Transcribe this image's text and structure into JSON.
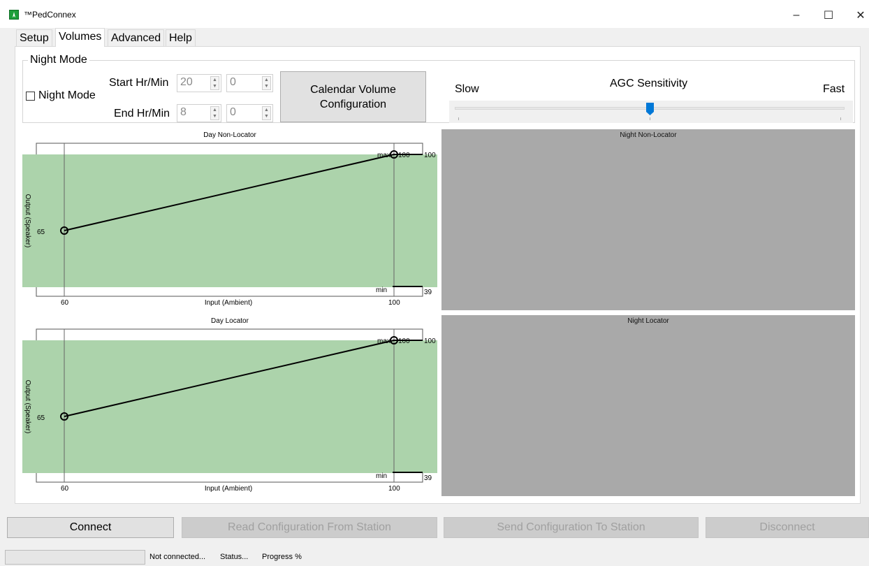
{
  "window": {
    "title": "™PedConnex",
    "controls": {
      "minimize": "–",
      "maximize": "☐",
      "close": "✕"
    }
  },
  "tabs": [
    {
      "label": "Setup",
      "active": false
    },
    {
      "label": "Volumes",
      "active": true
    },
    {
      "label": "Advanced",
      "active": false
    },
    {
      "label": "Help",
      "active": false
    }
  ],
  "night_mode": {
    "group_title": "Night Mode",
    "checkbox_label": "Night Mode",
    "checked": false,
    "start_label": "Start Hr/Min",
    "end_label": "End Hr/Min",
    "start_hour": "20",
    "start_min": "0",
    "end_hour": "8",
    "end_min": "0",
    "calendar_button_line1": "Calendar Volume",
    "calendar_button_line2": "Configuration"
  },
  "agc": {
    "title": "AGC Sensitivity",
    "min_label": "Slow",
    "max_label": "Fast",
    "position_fraction": 0.5
  },
  "charts": {
    "day_non_locator": {
      "title": "Day Non-Locator",
      "xlabel": "Input (Ambient)",
      "ylabel": "Output (Speaker)",
      "x_ticks": [
        "60",
        "100"
      ],
      "y_low_label": "65",
      "max_label": "max",
      "max_value_label": "100",
      "right_max_label": "100",
      "min_label": "min",
      "right_min_label": "39"
    },
    "day_locator": {
      "title": "Day Locator",
      "xlabel": "Input (Ambient)",
      "ylabel": "Output (Speaker)",
      "x_ticks": [
        "60",
        "100"
      ],
      "y_low_label": "65",
      "max_label": "max",
      "max_value_label": "100",
      "right_max_label": "100",
      "min_label": "min",
      "right_min_label": "39"
    },
    "night_non_locator": {
      "title": "Night Non-Locator"
    },
    "night_locator": {
      "title": "Night Locator"
    }
  },
  "chart_data": [
    {
      "type": "line",
      "title": "Day Non-Locator",
      "xlabel": "Input (Ambient)",
      "ylabel": "Output (Speaker)",
      "x": [
        60,
        100
      ],
      "y": [
        65,
        100
      ],
      "max": 100,
      "min": 39
    },
    {
      "type": "line",
      "title": "Day Locator",
      "xlabel": "Input (Ambient)",
      "ylabel": "Output (Speaker)",
      "x": [
        60,
        100
      ],
      "y": [
        65,
        100
      ],
      "max": 100,
      "min": 39
    }
  ],
  "buttons": {
    "connect": "Connect",
    "read": "Read Configuration From Station",
    "send": "Send Configuration To Station",
    "disconnect": "Disconnect"
  },
  "status": {
    "connection": "Not connected...",
    "status": "Status...",
    "progress": "Progress %"
  },
  "colors": {
    "green_band": "#acd3ab",
    "night_gray": "#a9a9a9",
    "slider_thumb": "#0078d7",
    "app_icon": "#1e9e3a"
  }
}
